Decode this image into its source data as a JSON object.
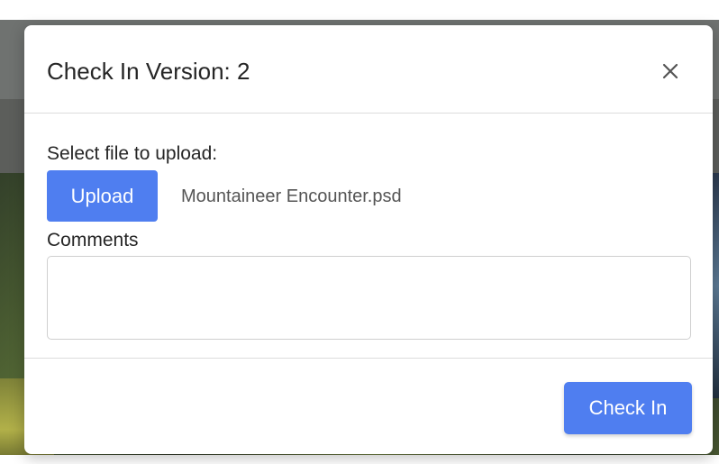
{
  "dialog": {
    "title": "Check In Version: 2",
    "close_icon": "close-icon"
  },
  "upload": {
    "label": "Select file to upload:",
    "button_label": "Upload",
    "file_name": "Mountaineer Encounter.psd"
  },
  "comments": {
    "label": "Comments",
    "value": "",
    "placeholder": ""
  },
  "footer": {
    "checkin_label": "Check In"
  },
  "colors": {
    "primary_button": "#4f7ef0",
    "title_text": "#262626",
    "secondary_text": "#555555"
  }
}
